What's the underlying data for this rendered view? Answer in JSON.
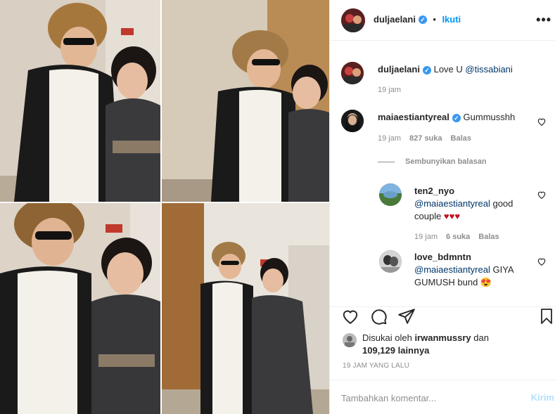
{
  "post": {
    "author": "duljaelani",
    "follow_label": "Ikuti",
    "more_label": "•••",
    "separator": "•",
    "verified_mark": "✓"
  },
  "caption": {
    "username": "duljaelani",
    "text": "Love U ",
    "mention": "@tissabiani",
    "time": "19 jam"
  },
  "comments": [
    {
      "username": "maiaestiantyreal",
      "text": "Gummusshh",
      "time": "19 jam",
      "likes": "827 suka",
      "reply_label": "Balas",
      "verified": true
    }
  ],
  "hide_replies_label": "Sembunyikan balasan",
  "replies": [
    {
      "username": "ten2_nyo",
      "mention": "@maiaestiantyreal",
      "text": " good couple ",
      "emoji": "♥♥♥",
      "time": "19 jam",
      "likes": "6 suka",
      "reply_label": "Balas"
    },
    {
      "username": "love_bdmntn",
      "mention": "@maiaestiantyreal",
      "text": " GIYA GUMUSH bund ",
      "emoji": "😍"
    }
  ],
  "likes": {
    "prefix": "Disukai oleh ",
    "user": "irwanmussry",
    "middle": " dan",
    "count": "109,129 lainnya"
  },
  "time_ago": "19 JAM YANG LALU",
  "add_comment": {
    "placeholder": "Tambahkan komentar...",
    "post_label": "Kirim"
  },
  "icons": {
    "like": "heart-icon",
    "comment": "comment-icon",
    "share": "share-icon",
    "save": "bookmark-icon",
    "more": "more-icon"
  },
  "colors": {
    "accent": "#0095f6",
    "verified": "#3897f0",
    "heart_emoji": "#c1121f"
  }
}
